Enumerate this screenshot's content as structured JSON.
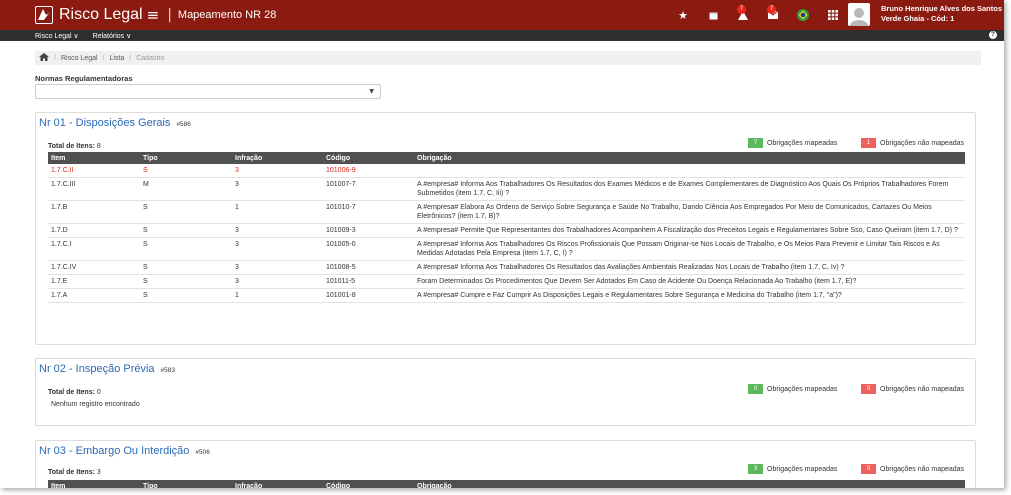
{
  "header": {
    "brand": "Risco Legal",
    "hamburger": "≡",
    "separator": "|",
    "module_title": "Mapeamento NR 28",
    "badges": {
      "alerts": "7",
      "messages": "7"
    },
    "user_name": "Bruno Henrique Alves dos Santos",
    "user_company": "Verde Ghaia - Cód: 1"
  },
  "menu": {
    "items": [
      "Risco Legal ∨",
      "Relatórios ∨"
    ],
    "help": "?"
  },
  "breadcrumb": {
    "items": [
      "Risco Legal",
      "Lista",
      "Cadastro"
    ]
  },
  "filter": {
    "label": "Normas Regulamentadoras",
    "value": ""
  },
  "legend": {
    "mapped_label": "Obrigações mapeadas",
    "unmapped_label": "Obrigações não mapeadas"
  },
  "columns": [
    "Item",
    "Tipo",
    "Infração",
    "Código",
    "Obrigação"
  ],
  "panels": [
    {
      "title": "Nr 01 - Disposições Gerais",
      "id": "#586",
      "total_label": "Total de Itens:",
      "total": "8",
      "mapped": "7",
      "unmapped": "1",
      "rows": [
        {
          "item": "1.7.C.II",
          "tipo": "S",
          "infracao": "3",
          "codigo": "101006-9",
          "obrigacao": "",
          "highlight": true
        },
        {
          "item": "1.7.C.III",
          "tipo": "M",
          "infracao": "3",
          "codigo": "101007-7",
          "obrigacao": "A #empresa# Informa Aos Trabalhadores Os Resultados dos Exames Médicos e de Exames Complementares de Diagnóstico Aos Quais Os Próprios Trabalhadores Forem Submetidos (item 1.7, C, Iii) ?"
        },
        {
          "item": "1.7.B",
          "tipo": "S",
          "infracao": "1",
          "codigo": "101010-7",
          "obrigacao": "A #empresa# Elabora As Ordens de Serviço Sobre Segurança e Saúde No Trabalho, Dando Ciência Aos Empregados Por Meio de Comunicados, Cartazes Ou Meios Eletrônicos? (item 1.7, B)?"
        },
        {
          "item": "1.7.D",
          "tipo": "S",
          "infracao": "3",
          "codigo": "101009-3",
          "obrigacao": "A #empresa# Permite Que Representantes dos Trabalhadores Acompanhem A Fiscalização dos Preceitos Legais e Regulamentares Sobre Sso, Caso Queiram (item 1.7, D) ?"
        },
        {
          "item": "1.7.C.I",
          "tipo": "S",
          "infracao": "3",
          "codigo": "101005-0",
          "obrigacao": "A #empresa# Informa Aos Trabalhadores Os Riscos Profissionais Que Possam Originar-se Nos Locais de Trabalho, e Os Meios Para Prevenir e Limitar Tais Riscos e As Medidas Adotadas Pela Empresa (item 1.7, C, I) ?"
        },
        {
          "item": "1.7.C.IV",
          "tipo": "S",
          "infracao": "3",
          "codigo": "101008-5",
          "obrigacao": "A #empresa# Informa Aos Trabalhadores Os Resultados das Avaliações Ambientais Realizadas Nos Locais de Trabalho (item 1.7, C, Iv) ?"
        },
        {
          "item": "1.7.E",
          "tipo": "S",
          "infracao": "3",
          "codigo": "101011-5",
          "obrigacao": "Foram Determinados Os Procedimentos Que Devem Ser Adotados Em Caso de Acidente Ou Doença Relacionada Ao Trabalho (item 1.7, E)?"
        },
        {
          "item": "1.7.A",
          "tipo": "S",
          "infracao": "1",
          "codigo": "101001-8",
          "obrigacao": "A #empresa# Cumpre e Faz Cumprir As Disposições Legais e Regulamentares Sobre Segurança e Medicina do Trabalho (item 1.7, \"a\")?"
        }
      ]
    },
    {
      "title": "Nr 02 - Inspeção Prévia",
      "id": "#583",
      "total_label": "Total de Itens:",
      "total": "0",
      "mapped": "0",
      "unmapped": "0",
      "empty": "Nenhum registro encontrado"
    },
    {
      "title": "Nr 03 - Embargo Ou Interdição",
      "id": "#506",
      "total_label": "Total de Itens:",
      "total": "3",
      "mapped": "3",
      "unmapped": "0"
    }
  ],
  "colors": {
    "topbar": "#8b1a10",
    "menubar": "#2f2f2f",
    "title": "#2a6ab5",
    "highlight": "#e0261c",
    "mapped": "#5cb85c",
    "unmapped": "#f0605c"
  }
}
